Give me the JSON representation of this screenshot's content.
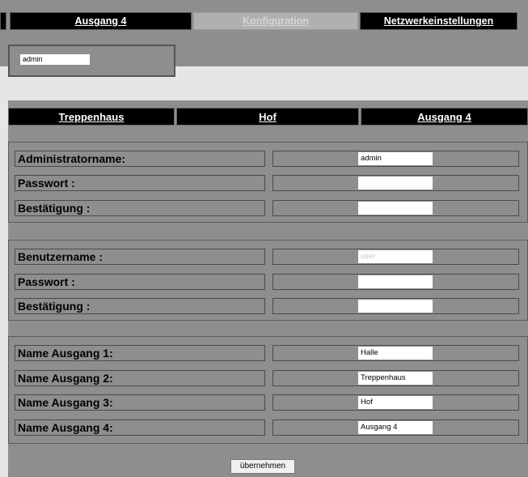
{
  "top_tabs": [
    "Ausgang 4",
    "Konfiguration",
    "Netzwerkeinstellungen"
  ],
  "top_admin_value": "admin",
  "tabs": [
    "Treppenhaus",
    "Hof",
    "Ausgang 4"
  ],
  "admin_section": {
    "rows": [
      {
        "label": "Administratorname:",
        "value": "admin"
      },
      {
        "label": "Passwort :",
        "value": ""
      },
      {
        "label": "Bestätigung :",
        "value": ""
      }
    ]
  },
  "user_section": {
    "rows": [
      {
        "label": "Benutzername :",
        "placeholder": "user",
        "value": ""
      },
      {
        "label": "Passwort :",
        "value": ""
      },
      {
        "label": "Bestätigung :",
        "value": ""
      }
    ]
  },
  "outputs_section": {
    "rows": [
      {
        "label": "Name Ausgang 1:",
        "value": "Halle"
      },
      {
        "label": "Name Ausgang 2:",
        "value": "Treppenhaus"
      },
      {
        "label": "Name Ausgang 3:",
        "value": "Hof"
      },
      {
        "label": "Name Ausgang 4:",
        "value": "Ausgang 4"
      }
    ]
  },
  "submit_label": "übernehmen"
}
